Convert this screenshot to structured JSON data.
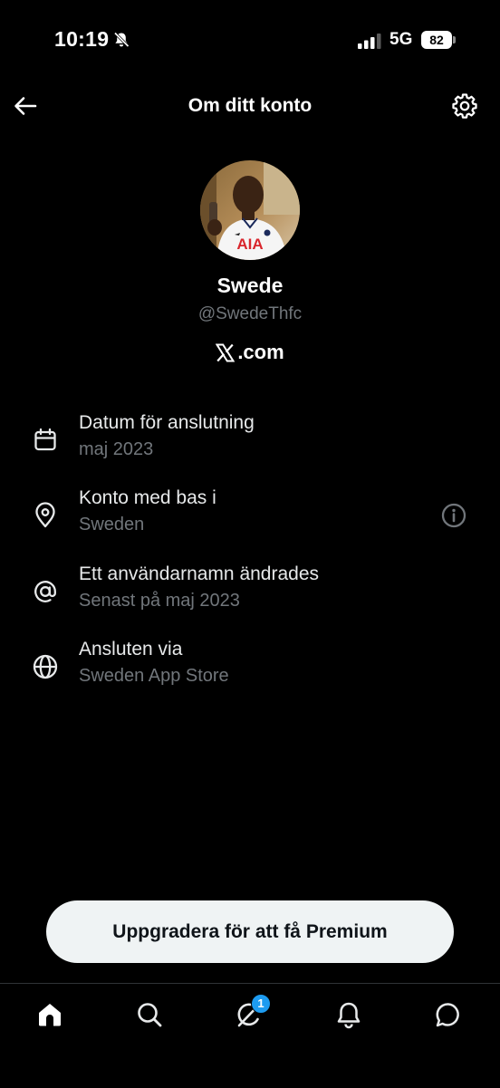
{
  "status_bar": {
    "time": "10:19",
    "network": "5G",
    "battery": "82",
    "icons": [
      "mute-icon",
      "signal-icon",
      "battery-icon"
    ]
  },
  "header": {
    "title": "Om ditt konto",
    "left_icon": "back-arrow-icon",
    "right_icon": "gear-icon"
  },
  "profile": {
    "display_name": "Swede",
    "handle": "@SwedeThfc",
    "source_label": ".com",
    "avatar_icon": "avatar",
    "avatar_shirt_text": "AIA"
  },
  "info_items": [
    {
      "icon": "calendar-icon",
      "title": "Datum för anslutning",
      "value": "maj 2023"
    },
    {
      "icon": "location-pin-icon",
      "title": "Konto med bas i",
      "value": "Sweden",
      "action_icon": "info-icon"
    },
    {
      "icon": "at-sign-icon",
      "title": "Ett användarnamn ändrades",
      "value": "Senast på maj 2023"
    },
    {
      "icon": "globe-icon",
      "title": "Ansluten via",
      "value": "Sweden App Store"
    }
  ],
  "premium": {
    "label": "Uppgradera för att få Premium"
  },
  "tab_bar": {
    "tabs": [
      {
        "icon": "home-icon",
        "active": true
      },
      {
        "icon": "search-icon",
        "active": false
      },
      {
        "icon": "grok-icon",
        "active": false,
        "badge": "1"
      },
      {
        "icon": "bell-icon",
        "active": false
      },
      {
        "icon": "messages-icon",
        "active": false
      }
    ]
  },
  "colors": {
    "background": "#000000",
    "text_primary": "#e7e9ea",
    "text_secondary": "#71767b",
    "button_bg": "#eff3f4",
    "badge": "#1d9bf0",
    "divider": "#2f3336"
  }
}
